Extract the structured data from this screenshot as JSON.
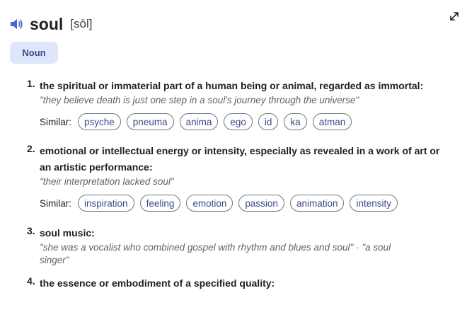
{
  "entry": {
    "word": "soul",
    "phonetic": "[sōl]",
    "speaker_icon": "speaker-icon",
    "expand_icon": "expand-icon"
  },
  "part_of_speech": "Noun",
  "similar_label": "Similar:",
  "definitions": [
    {
      "number": "1.",
      "text": "the spiritual or immaterial part of a human being or animal, regarded as immortal:",
      "example": "\"they believe death is just one step in a soul's journey through the universe\"",
      "similar": [
        "psyche",
        "pneuma",
        "anima",
        "ego",
        "id",
        "ka",
        "atman"
      ]
    },
    {
      "number": "2.",
      "text": "emotional or intellectual energy or intensity, especially as revealed in a work of art or an artistic performance:",
      "example": "\"their interpretation lacked soul\"",
      "similar": [
        "inspiration",
        "feeling",
        "emotion",
        "passion",
        "animation",
        "intensity"
      ]
    },
    {
      "number": "3.",
      "text": "soul music:",
      "example": "\"she was a vocalist who combined gospel with rhythm and blues and soul\" · \"a soul singer\""
    },
    {
      "number": "4.",
      "text": "the essence or embodiment of a specified quality:"
    }
  ]
}
